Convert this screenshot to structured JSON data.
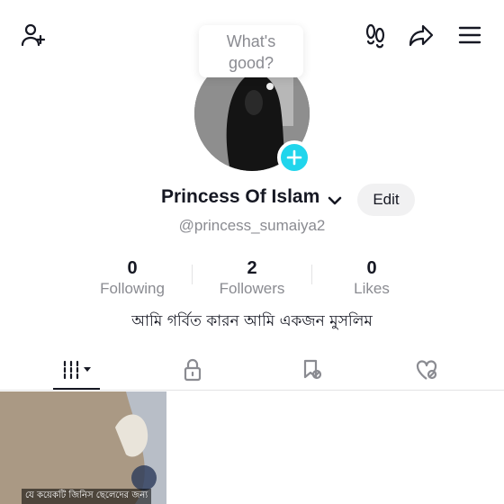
{
  "header": {
    "left_icon": "add-friend-icon",
    "right_icons": [
      "footprints-icon",
      "share-icon",
      "menu-icon"
    ]
  },
  "prompt_bubble": {
    "text": "What's\ngood?"
  },
  "profile": {
    "avatar_icon": "avatar",
    "add_icon": "plus-icon",
    "accent_color": "#20d5ec",
    "name": "Princess Of Islam",
    "edit_label": "Edit",
    "username": "@princess_sumaiya2",
    "bio": "আমি গর্বিত কারন আমি একজন মুসলিম"
  },
  "stats": [
    {
      "value": "0",
      "label": "Following"
    },
    {
      "value": "2",
      "label": "Followers"
    },
    {
      "value": "0",
      "label": "Likes"
    }
  ],
  "tabs": [
    {
      "icon": "grid-icon",
      "active": true
    },
    {
      "icon": "lock-icon",
      "active": false
    },
    {
      "icon": "bookmark-icon",
      "active": false
    },
    {
      "icon": "liked-icon",
      "active": false
    }
  ],
  "videos": [
    {
      "caption": "যে কয়েকটি জিনিস ছেলেদের জন্য"
    }
  ]
}
